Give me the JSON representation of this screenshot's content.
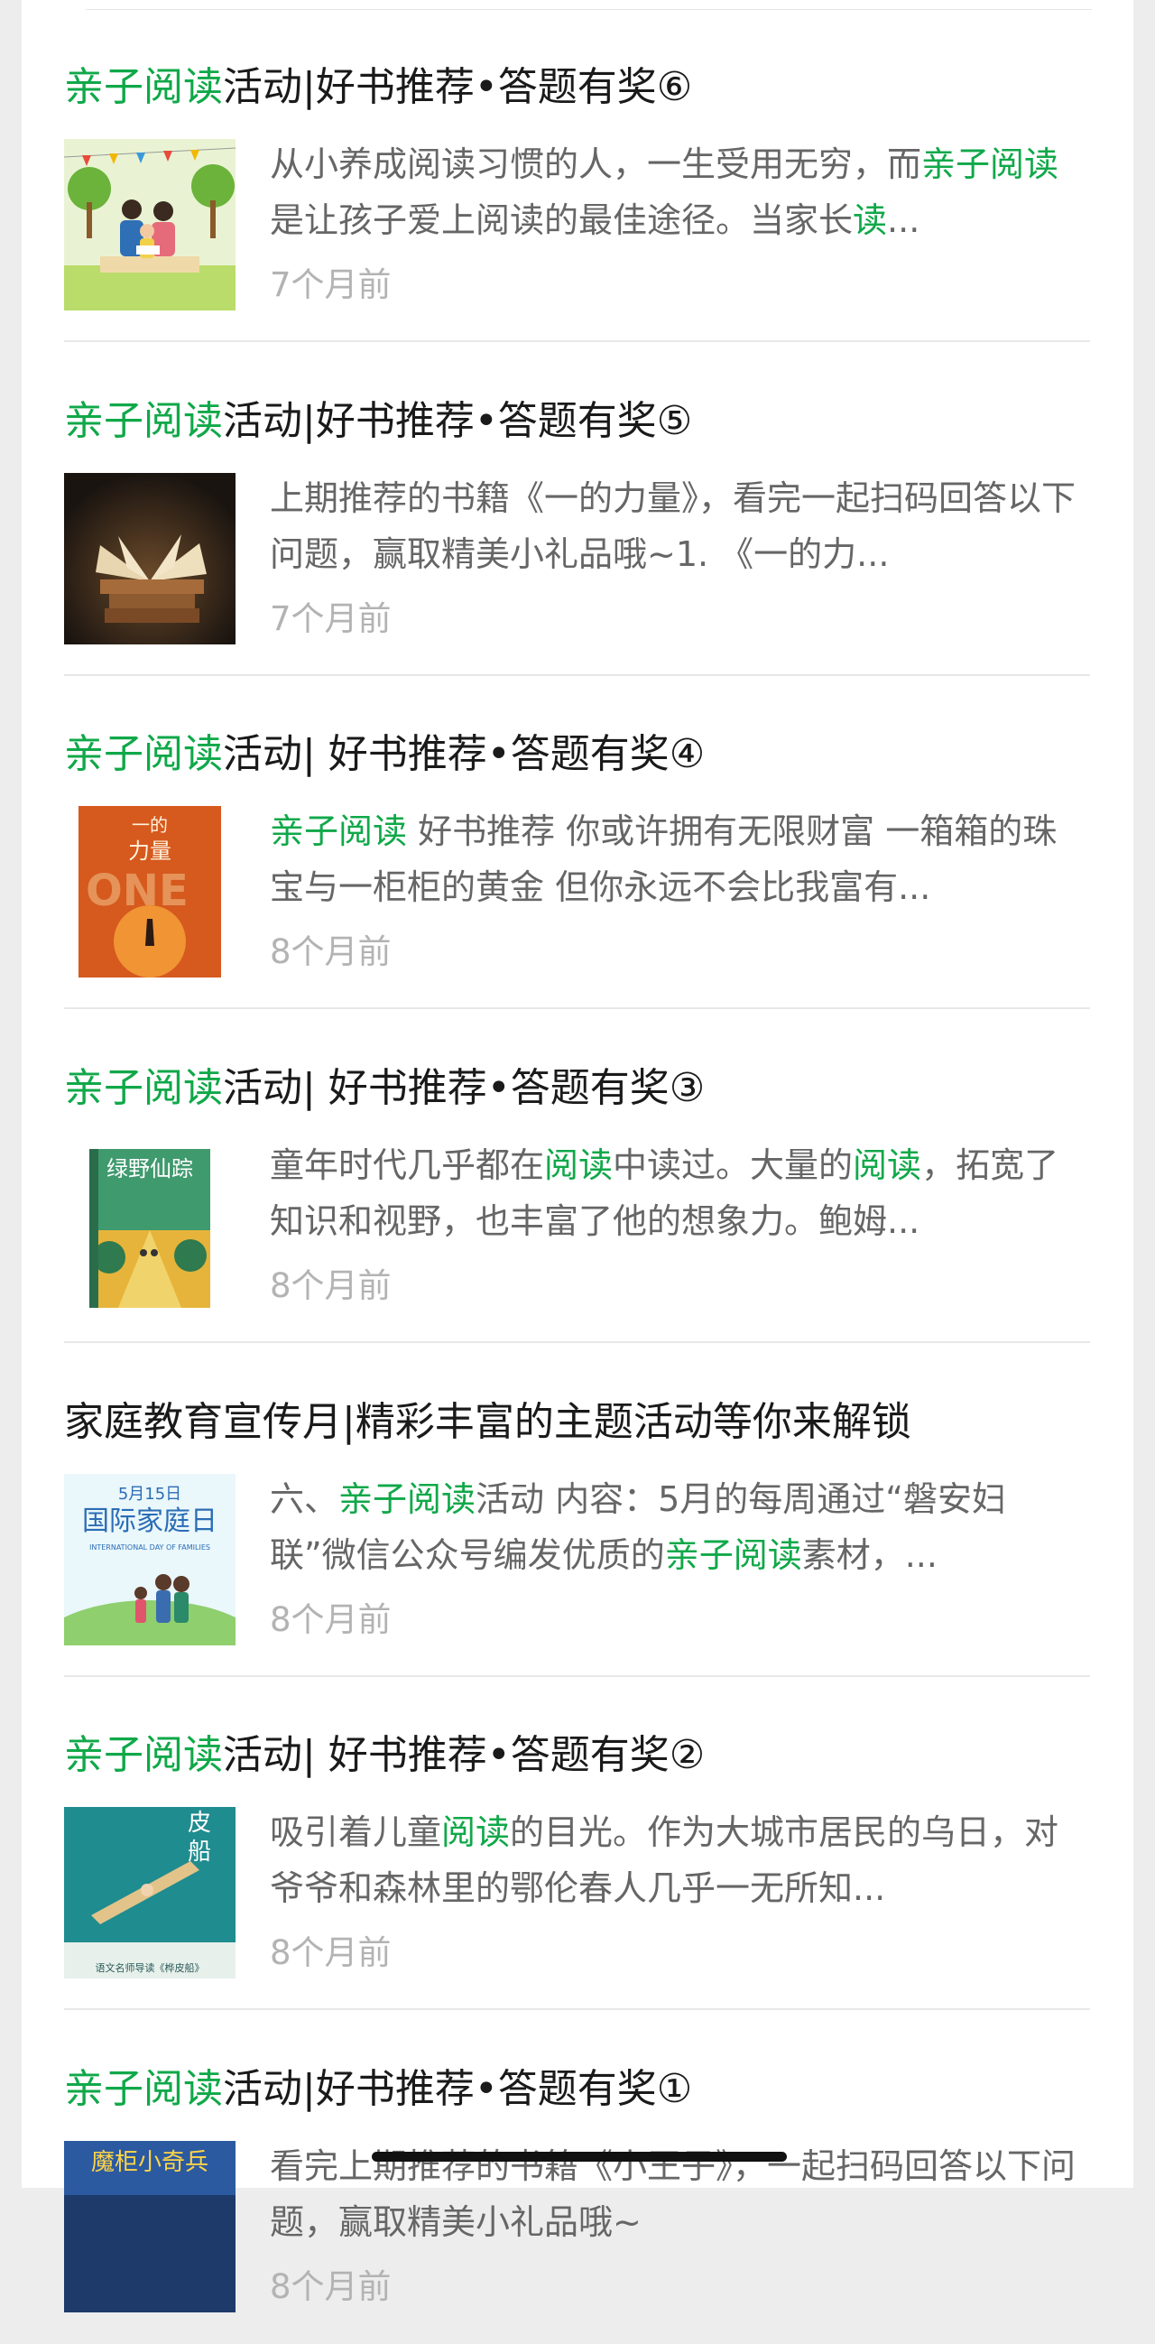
{
  "colors": {
    "highlight": "#10a849",
    "title": "#1a1a1a",
    "desc": "#666666",
    "time": "#b3b3b3"
  },
  "articles": [
    {
      "title": [
        {
          "t": "亲子阅读",
          "hl": true
        },
        {
          "t": "活动|好书推荐•答题有奖⑥",
          "hl": false
        }
      ],
      "desc": [
        {
          "t": "从小养成阅读习惯的人，一生受用无穷，而",
          "hl": false
        },
        {
          "t": "亲子阅读",
          "hl": true
        },
        {
          "t": "是让孩子爱上阅读的最佳途径。当家长",
          "hl": false
        },
        {
          "t": "读",
          "hl": true
        },
        {
          "t": "...",
          "hl": false
        }
      ],
      "time": "7个月前",
      "thumb_icon": "parent-child-reading-illustration"
    },
    {
      "title": [
        {
          "t": "亲子阅读",
          "hl": true
        },
        {
          "t": "活动|好书推荐•答题有奖⑤",
          "hl": false
        }
      ],
      "desc": [
        {
          "t": "上期推荐的书籍《一的力量》，看完一起扫码回答以下问题，赢取精美小礼品哦~1. 《一的力...",
          "hl": false
        }
      ],
      "time": "7个月前",
      "thumb_icon": "open-book-photo"
    },
    {
      "title": [
        {
          "t": "亲子阅读",
          "hl": true
        },
        {
          "t": "活动| 好书推荐•答题有奖④",
          "hl": false
        }
      ],
      "desc": [
        {
          "t": "亲子阅读",
          "hl": true
        },
        {
          "t": " 好书推荐 你或许拥有无限财富 一箱箱的珠宝与一柜柜的黄金 但你永远不会比我富有...",
          "hl": false
        }
      ],
      "time": "8个月前",
      "thumb_icon": "book-cover-power-of-one",
      "thumb_text": [
        "一的",
        "力量"
      ]
    },
    {
      "title": [
        {
          "t": "亲子阅读",
          "hl": true
        },
        {
          "t": "活动| 好书推荐•答题有奖③",
          "hl": false
        }
      ],
      "desc": [
        {
          "t": "童年时代几乎都在",
          "hl": false
        },
        {
          "t": "阅读",
          "hl": true
        },
        {
          "t": "中读过。大量的",
          "hl": false
        },
        {
          "t": "阅读",
          "hl": true
        },
        {
          "t": "，拓宽了知识和视野，也丰富了他的想象力。鲍姆...",
          "hl": false
        }
      ],
      "time": "8个月前",
      "thumb_icon": "book-cover-wizard-of-oz",
      "thumb_text": [
        "绿野仙踪"
      ]
    },
    {
      "title": [
        {
          "t": "家庭教育宣传月|精彩丰富的主题活动等你来解锁",
          "hl": false
        }
      ],
      "desc": [
        {
          "t": "六、",
          "hl": false
        },
        {
          "t": "亲子阅读",
          "hl": true
        },
        {
          "t": "活动 内容：5月的每周通过“磐安妇联”微信公众号编发优质的",
          "hl": false
        },
        {
          "t": "亲子阅读",
          "hl": true
        },
        {
          "t": "素材，...",
          "hl": false
        }
      ],
      "time": "8个月前",
      "thumb_icon": "international-day-of-families-poster",
      "thumb_text": [
        "5月15日",
        "国际家庭日",
        "INTERNATIONAL DAY OF FAMILIES"
      ]
    },
    {
      "title": [
        {
          "t": "亲子阅读",
          "hl": true
        },
        {
          "t": "活动| 好书推荐•答题有奖②",
          "hl": false
        }
      ],
      "desc": [
        {
          "t": "吸引着儿童",
          "hl": false
        },
        {
          "t": "阅读",
          "hl": true
        },
        {
          "t": "的目光。作为大城市居民的乌日，对爷爷和森林里的鄂伦春人几乎一无所知...",
          "hl": false
        }
      ],
      "time": "8个月前",
      "thumb_icon": "book-cover-canoe",
      "thumb_text": [
        "皮",
        "船",
        "语文名师导读《桦皮船》"
      ]
    },
    {
      "title": [
        {
          "t": "亲子阅读",
          "hl": true
        },
        {
          "t": "活动|好书推荐•答题有奖①",
          "hl": false
        }
      ],
      "desc": [
        {
          "t": "看完上期推荐的书籍《小王子》，一起扫码回答以下问题，赢取精美小礼品哦~",
          "hl": false
        }
      ],
      "time": "8个月前",
      "thumb_icon": "book-cover-little-soldier",
      "thumb_text": [
        "魔柜小奇兵"
      ]
    }
  ]
}
